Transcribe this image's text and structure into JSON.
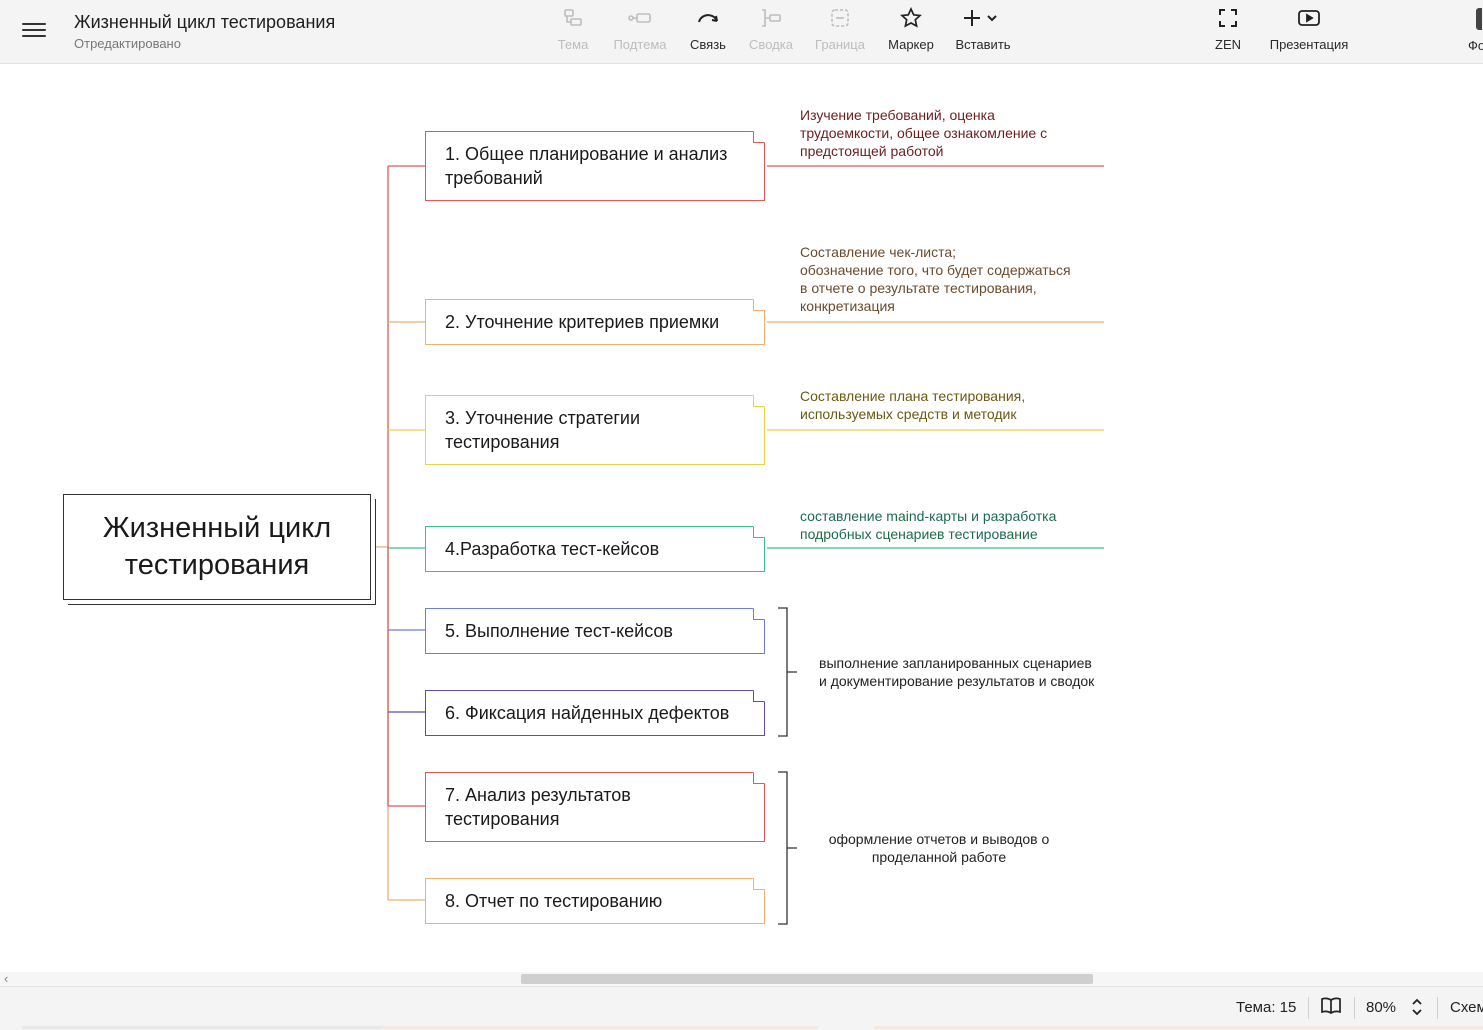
{
  "header": {
    "title": "Жизненный цикл тестирования",
    "subtitle": "Отредактировано"
  },
  "toolbar": {
    "theme": "Тема",
    "subtheme": "Подтема",
    "link": "Связь",
    "summary": "Сводка",
    "boundary": "Граница",
    "marker": "Маркер",
    "insert": "Вставить",
    "zen": "ZEN",
    "presentation": "Презентация",
    "format": "Фо"
  },
  "map": {
    "central": "Жизненный цикл\nтестирования",
    "topics": [
      {
        "label": "1. Общее планирование и анализ требований",
        "color": "#e05a5a",
        "note": "Изучение требований, оценка\nтрудоемкости, общее ознакомление с\nпредстоящей работой",
        "note_color": "#6b1e1e"
      },
      {
        "label": "2. Уточнение критериев приемки",
        "color": "#f2b06e",
        "note": "Составление чек-листа;\nобозначение того, что будет содержаться\nв отчете о результате тестирования,\nконкретизация",
        "note_color": "#6b4a2a"
      },
      {
        "label": "3. Уточнение стратегии тестирования",
        "color": "#e8d24a",
        "note": "Составление плана тестирования,\nиспользуемых средств и методик",
        "note_color": "#6a5a12"
      },
      {
        "label": "4.Разработка тест-кейсов",
        "color": "#3dbe8f",
        "note": "составление maind-карты и разработка\nподробных сценариев тестирование",
        "note_color": "#1d6b4d"
      },
      {
        "label": "5. Выполнение тест-кейсов",
        "color": "#6e7ed8",
        "note": "",
        "note_color": ""
      },
      {
        "label": "6. Фиксация найденных дефектов",
        "color": "#5a4fb0",
        "note": "",
        "note_color": ""
      },
      {
        "label": "7. Анализ результатов тестирования",
        "color": "#e05a5a",
        "note": "",
        "note_color": ""
      },
      {
        "label": "8. Отчет по тестированию",
        "color": "#f2b06e",
        "note": "",
        "note_color": ""
      }
    ],
    "summaries": [
      {
        "text": "выполнение запланированных сценариев\nи документирование результатов и сводок"
      },
      {
        "text": "оформление отчетов и выводов о\nпроделанной работе"
      }
    ]
  },
  "status": {
    "topic_count": "Тема: 15",
    "zoom": "80%",
    "scheme": "Схем"
  }
}
